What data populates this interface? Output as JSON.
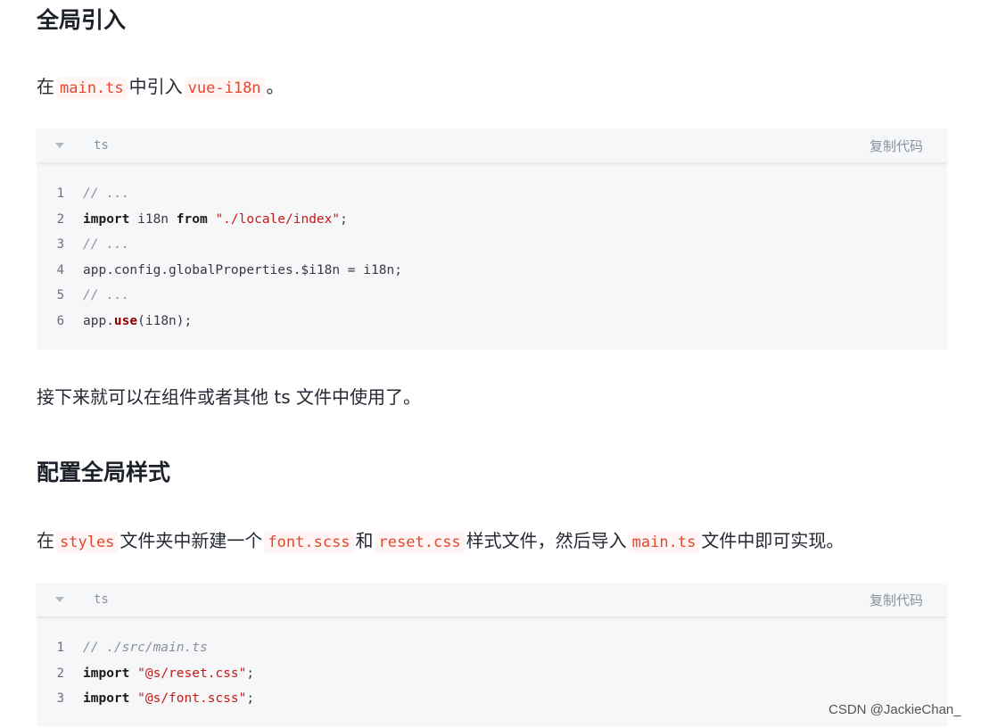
{
  "section1": {
    "heading": "全局引入",
    "para": {
      "t1": "在",
      "c1": "main.ts",
      "t2": "中引入",
      "c2": "vue-i18n",
      "t3": "。"
    }
  },
  "code1": {
    "lang": "ts",
    "copy_label": "复制代码",
    "line_numbers": [
      "1",
      "2",
      "3",
      "4",
      "5",
      "6"
    ],
    "lines": {
      "l1": "// ...",
      "l2": {
        "kw1": "import",
        "mid": " i18n ",
        "kw2": "from",
        "sp": " ",
        "str": "\"./locale/index\"",
        "end": ";"
      },
      "l3": "// ...",
      "l4": "app.config.globalProperties.$i18n = i18n;",
      "l5": "// ...",
      "l6": {
        "pre": "app.",
        "fn": "use",
        "post": "(i18n);"
      }
    }
  },
  "para2": "接下来就可以在组件或者其他 ts 文件中使用了。",
  "section2": {
    "heading": "配置全局样式",
    "para": {
      "t1": "在",
      "c1": "styles",
      "t2": "文件夹中新建一个",
      "c2": "font.scss",
      "t3": "和",
      "c3": "reset.css",
      "t4": "样式文件，然后导入",
      "c4": "main.ts",
      "t5": "文件中即可实现。"
    }
  },
  "code2": {
    "lang": "ts",
    "copy_label": "复制代码",
    "line_numbers": [
      "1",
      "2",
      "3"
    ],
    "lines": {
      "l1": "// ./src/main.ts",
      "l2": {
        "kw": "import",
        "sp": " ",
        "str": "\"@s/reset.css\"",
        "end": ";"
      },
      "l3": {
        "kw": "import",
        "sp": " ",
        "str": "\"@s/font.scss\"",
        "end": ";"
      }
    }
  },
  "watermark": "CSDN @JackieChan_"
}
